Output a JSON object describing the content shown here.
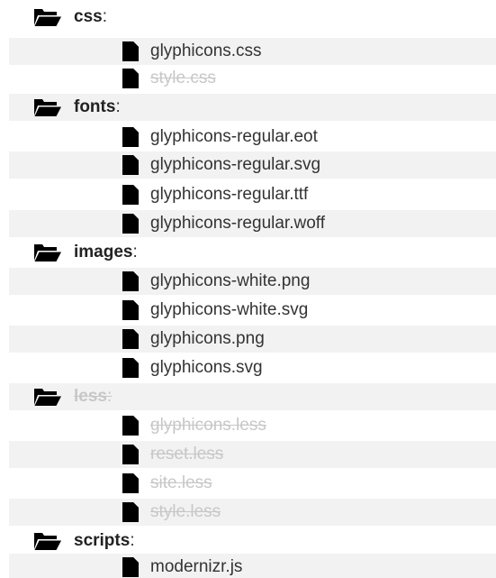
{
  "tree": {
    "css": {
      "name": "css",
      "separator": ":",
      "icon": "folder-open-icon",
      "files": [
        {
          "name": "glyphicons.css",
          "icon": "file-icon"
        },
        {
          "name": "style.css",
          "icon": "file-icon",
          "state": "removed"
        }
      ]
    },
    "fonts": {
      "name": "fonts",
      "separator": ":",
      "icon": "folder-open-icon",
      "files": [
        {
          "name": "glyphicons-regular.eot",
          "icon": "file-icon"
        },
        {
          "name": "glyphicons-regular.svg",
          "icon": "file-icon"
        },
        {
          "name": "glyphicons-regular.ttf",
          "icon": "file-icon"
        },
        {
          "name": "glyphicons-regular.woff",
          "icon": "file-icon"
        }
      ]
    },
    "images": {
      "name": "images",
      "separator": ":",
      "icon": "folder-open-icon",
      "files": [
        {
          "name": "glyphicons-white.png",
          "icon": "file-icon"
        },
        {
          "name": "glyphicons-white.svg",
          "icon": "file-icon"
        },
        {
          "name": "glyphicons.png",
          "icon": "file-icon"
        },
        {
          "name": "glyphicons.svg",
          "icon": "file-icon"
        }
      ]
    },
    "less": {
      "name": "less",
      "separator": ":",
      "icon": "folder-open-icon",
      "state": "removed",
      "files": [
        {
          "name": "glyphicons.less",
          "icon": "file-icon",
          "state": "removed"
        },
        {
          "name": "reset.less",
          "icon": "file-icon",
          "state": "removed"
        },
        {
          "name": "site.less",
          "icon": "file-icon",
          "state": "removed"
        },
        {
          "name": "style.less",
          "icon": "file-icon",
          "state": "removed"
        }
      ]
    },
    "scripts": {
      "name": "scripts",
      "separator": ":",
      "icon": "folder-open-icon",
      "files": [
        {
          "name": "modernizr.js",
          "icon": "file-icon"
        }
      ]
    }
  },
  "colors": {
    "row_shade": "#f2f2f2",
    "text": "#333333",
    "folder_icon": "#2f2f2f",
    "file_icon": "#8a8a8a",
    "removed": "#c7c7c7"
  }
}
